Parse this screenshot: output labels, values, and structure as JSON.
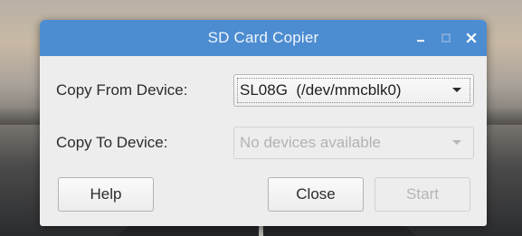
{
  "window": {
    "title": "SD Card Copier",
    "controls": {
      "minimize_icon": "minimize-icon",
      "maximize_icon": "maximize-icon",
      "close_icon": "close-icon"
    }
  },
  "form": {
    "from_label": "Copy From Device:",
    "from_value": "SL08G  (/dev/mmcblk0)",
    "to_label": "Copy To Device:",
    "to_value": "No devices available"
  },
  "buttons": {
    "help": "Help",
    "close": "Close",
    "start": "Start"
  },
  "colors": {
    "titlebar": "#4c8cd1",
    "dialog_bg": "#ededed",
    "disabled_text": "#b3b3b3"
  }
}
